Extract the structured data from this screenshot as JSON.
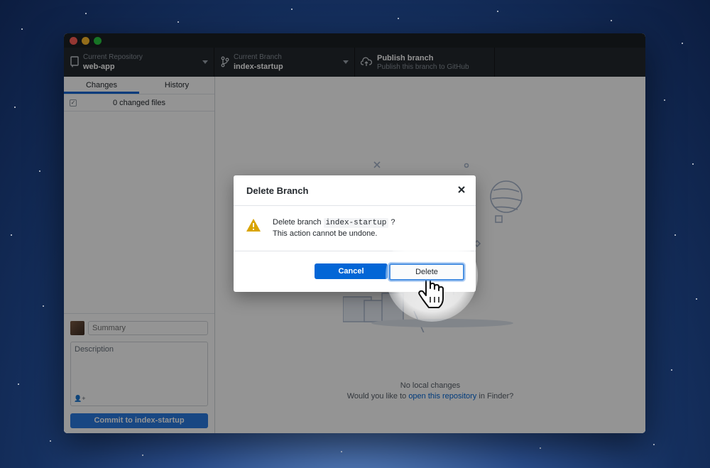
{
  "toolbar": {
    "repo": {
      "sub": "Current Repository",
      "main": "web-app"
    },
    "branch": {
      "sub": "Current Branch",
      "main": "index-startup"
    },
    "publish": {
      "main": "Publish branch",
      "sub": "Publish this branch to GitHub"
    }
  },
  "sidebar": {
    "tabs": [
      {
        "label": "Changes"
      },
      {
        "label": "History"
      }
    ],
    "changed_files": "0 changed files",
    "commit": {
      "summary_placeholder": "Summary",
      "description_placeholder": "Description",
      "button_label": "Commit to index-startup"
    }
  },
  "main": {
    "empty_title": "No local changes",
    "empty_prefix": "Would you like to ",
    "empty_link": "open this repository",
    "empty_suffix": " in Finder?"
  },
  "dialog": {
    "title": "Delete Branch",
    "message_prefix": "Delete branch ",
    "branch_name": "index-startup",
    "message_suffix": " ?",
    "warning": "This action cannot be undone.",
    "cancel_label": "Cancel",
    "delete_label": "Delete"
  },
  "colors": {
    "accent": "#0366d6",
    "toolbar_bg": "#24292e",
    "warning": "#d9a400"
  }
}
